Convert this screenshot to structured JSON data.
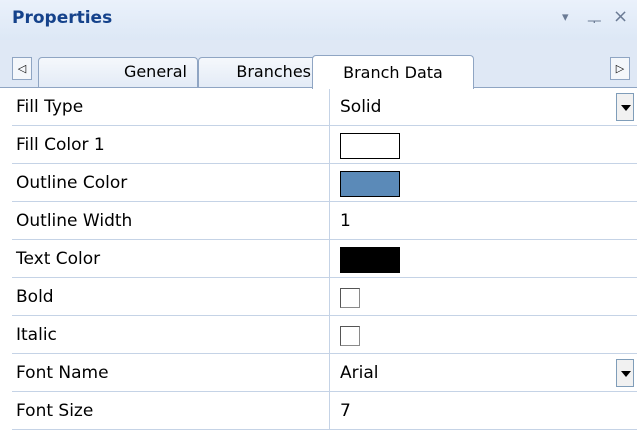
{
  "panel": {
    "title": "Properties",
    "dropdown_glyph": "▾",
    "pin_glyph": "ᅮ",
    "close_glyph": "×"
  },
  "tabs": {
    "scroll_left_glyph": "◁",
    "scroll_right_glyph": "▷",
    "items": [
      "General",
      "Branches",
      "Branch Data"
    ],
    "selected": "Branch Data"
  },
  "properties": [
    {
      "name": "Fill Type",
      "type": "dropdown",
      "value": "Solid"
    },
    {
      "name": "Fill Color 1",
      "type": "color",
      "color": "#ffffff"
    },
    {
      "name": "Outline Color",
      "type": "color",
      "color": "#5b8ab8"
    },
    {
      "name": "Outline Width",
      "type": "text",
      "value": "1"
    },
    {
      "name": "Text Color",
      "type": "color",
      "color": "#000000"
    },
    {
      "name": "Bold",
      "type": "checkbox",
      "checked": false
    },
    {
      "name": "Italic",
      "type": "checkbox",
      "checked": false
    },
    {
      "name": "Font Name",
      "type": "dropdown",
      "value": "Arial"
    },
    {
      "name": "Font Size",
      "type": "text",
      "value": "7"
    }
  ]
}
